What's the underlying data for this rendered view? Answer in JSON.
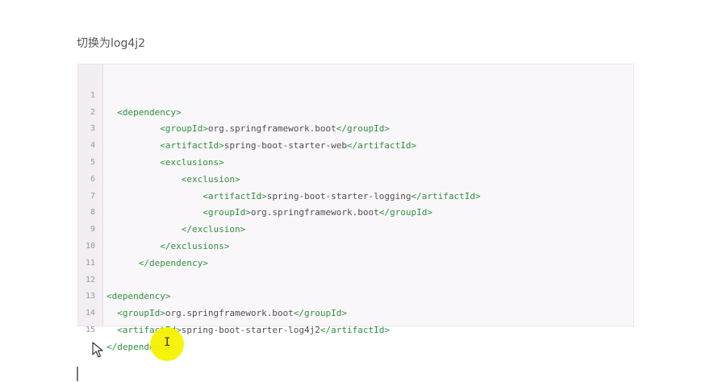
{
  "section_title": "切换为log4j2",
  "code": {
    "lines": [
      {
        "no": "1",
        "indent": "  ",
        "open": "<dependency>",
        "text": "",
        "close": ""
      },
      {
        "no": "2",
        "indent": "          ",
        "open": "<groupId>",
        "text": "org.springframework.boot",
        "close": "</groupId>"
      },
      {
        "no": "3",
        "indent": "          ",
        "open": "<artifactId>",
        "text": "spring-boot-starter-web",
        "close": "</artifactId>"
      },
      {
        "no": "4",
        "indent": "          ",
        "open": "<exclusions>",
        "text": "",
        "close": ""
      },
      {
        "no": "5",
        "indent": "              ",
        "open": "<exclusion>",
        "text": "",
        "close": ""
      },
      {
        "no": "6",
        "indent": "                  ",
        "open": "<artifactId>",
        "text": "spring-boot-starter-logging",
        "close": "</artifactId>"
      },
      {
        "no": "7",
        "indent": "                  ",
        "open": "<groupId>",
        "text": "org.springframework.boot",
        "close": "</groupId>"
      },
      {
        "no": "8",
        "indent": "              ",
        "open": "</exclusion>",
        "text": "",
        "close": ""
      },
      {
        "no": "9",
        "indent": "          ",
        "open": "</exclusions>",
        "text": "",
        "close": ""
      },
      {
        "no": "10",
        "indent": "      ",
        "open": "</dependency>",
        "text": "",
        "close": ""
      },
      {
        "no": "11",
        "indent": "",
        "open": "",
        "text": "",
        "close": ""
      },
      {
        "no": "12",
        "indent": "",
        "open": "<dependency>",
        "text": "",
        "close": ""
      },
      {
        "no": "13",
        "indent": "  ",
        "open": "<groupId>",
        "text": "org.springframework.boot",
        "close": "</groupId>"
      },
      {
        "no": "14",
        "indent": "  ",
        "open": "<artifactId>",
        "text": "spring-boot-starter-log4j2",
        "close": "</artifactId>"
      },
      {
        "no": "15",
        "indent": "",
        "open": "</dependency>",
        "text": "",
        "close": ""
      }
    ]
  },
  "cursor": {
    "ibeam_glyph": "I",
    "highlight_color": "#f6f200"
  },
  "colors": {
    "tag": "#2f8f3f",
    "code_bg": "#faf7fa",
    "gutter_bg": "#f3eef3"
  }
}
